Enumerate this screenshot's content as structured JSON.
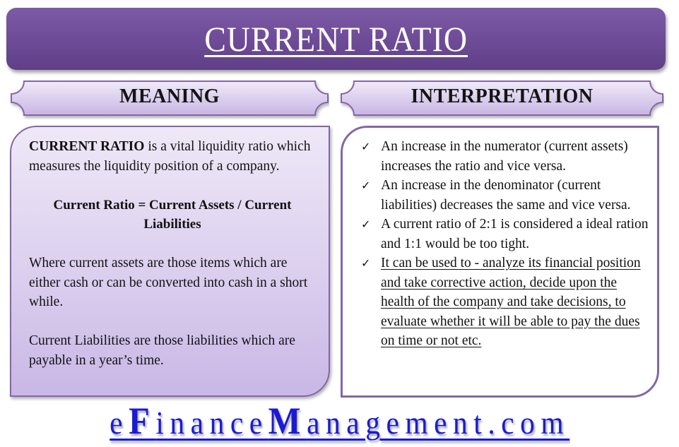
{
  "title": "CURRENT RATIO",
  "colors": {
    "banner": "#6f4c98",
    "panel_border": "#8466a8",
    "link": "#1a1ad6"
  },
  "meaning": {
    "header": "MEANING",
    "intro_bold": "CURRENT RATIO",
    "intro_rest": " is a vital liquidity ratio which measures the liquidity position of a company.",
    "formula_line1": "Current Ratio  = Current Assets / Current",
    "formula_line2": "Liabilities",
    "current_assets_def": "Where current assets are those items which are either cash or can be converted into cash in a short while.",
    "current_liabilities_def": "Current Liabilities are those liabilities which are payable in a year’s time."
  },
  "interpretation": {
    "header": "INTERPRETATION",
    "bullet_icon": "check-icon",
    "bullet_glyph": "✓",
    "bullets": [
      {
        "text": "An increase in the numerator (current assets) increases the ratio and vice versa."
      },
      {
        "text": "An increase in the denominator (current liabilities)  decreases the same and vice versa."
      },
      {
        "text": "A current ratio of 2:1 is  considered a ideal ration and 1:1 would be too tight."
      },
      {
        "text": "It can be used to - analyze its  financial position and take corrective action, decide upon the health of the company and take decisions, to evaluate whether it will be able to pay the dues on time or not etc."
      }
    ]
  },
  "footer": {
    "part1": "e",
    "part2": "F",
    "part3": "inance",
    "part4": "M",
    "part5": "anagement.com"
  }
}
